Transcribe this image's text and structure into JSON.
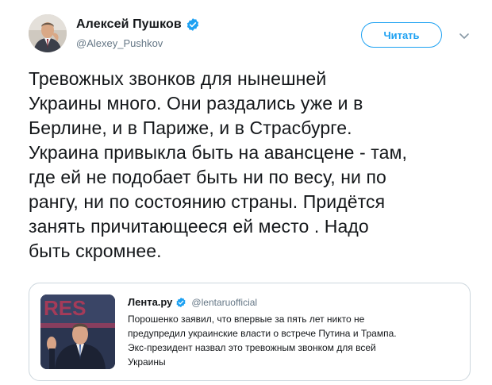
{
  "author": {
    "display_name": "Алексей Пушков",
    "handle": "@Alexey_Pushkov",
    "verified": true,
    "avatar_icon": "user-avatar-photo"
  },
  "actions": {
    "follow_label": "Читать",
    "menu_icon": "chevron-down-icon"
  },
  "tweet": {
    "text": "Тревожных звонков для нынешней\nУкраины много. Они раздались уже и в\nБерлине, и в Париже, и в Страсбурге.\nУкраина привыкла быть на авансцене - там,\nгде ей не подобает быть ни по весу, ни по\nрангу, ни по состоянию страны. Придётся\nзанять причитающееся ей место . Надо\nбыть скромнее."
  },
  "quoted_tweet": {
    "display_name": "Лента.ру",
    "handle": "@lentaruofficial",
    "verified": true,
    "media_icon": "news-photo-thumbnail",
    "text": "Порошенко заявил, что впервые за пять лет никто не\nпредупредил украинские власти о встрече Путина и Трампа.\nЭкс-президент назвал это тревожным звонком для всей\nУкраины"
  },
  "colors": {
    "accent": "#1da1f2",
    "text_primary": "#14171a",
    "text_secondary": "#657786",
    "border": "#ccd6dd"
  }
}
